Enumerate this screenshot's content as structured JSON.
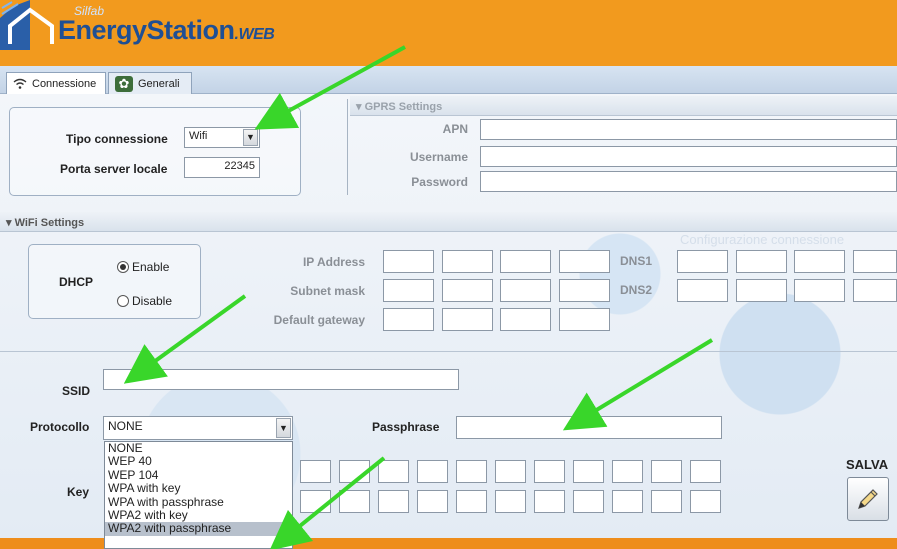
{
  "header": {
    "brand": "Silfab",
    "title": "EnergyStation",
    "title_suffix": ".WEB"
  },
  "tabs": [
    {
      "label": "Connessione",
      "icon": "wifi-icon",
      "active": true
    },
    {
      "label": "Generali",
      "icon": "gear-icon",
      "active": false
    }
  ],
  "connection": {
    "type_label": "Tipo connessione",
    "type_value": "Wifi",
    "port_label": "Porta server locale",
    "port_value": "22345"
  },
  "gprs": {
    "header": "GPRS Settings",
    "apn_label": "APN",
    "username_label": "Username",
    "password_label": "Password",
    "watermark": "Configurazione connessione"
  },
  "wifi": {
    "header": "WiFi Settings",
    "dhcp_label": "DHCP",
    "enable_label": "Enable",
    "disable_label": "Disable",
    "dhcp_selected": "Enable",
    "ip_label": "IP Address",
    "subnet_label": "Subnet mask",
    "gateway_label": "Default gateway",
    "dns1_label": "DNS1",
    "dns2_label": "DNS2"
  },
  "ssid": {
    "label": "SSID",
    "value": ""
  },
  "protocol": {
    "label": "Protocollo",
    "value": "NONE",
    "options": [
      "NONE",
      "WEP 40",
      "WEP 104",
      "WPA with key",
      "WPA with passphrase",
      "WPA2 with key",
      "WPA2 with passphrase"
    ],
    "highlighted": "WPA2 with passphrase"
  },
  "passphrase": {
    "label": "Passphrase",
    "value": ""
  },
  "key": {
    "label": "Key"
  },
  "save": {
    "label": "SALVA",
    "icon": "pencil-icon"
  },
  "colors": {
    "header_orange": "#f29a1e",
    "logo_blue": "#1f4f94",
    "arrow_green": "#39d62a"
  }
}
